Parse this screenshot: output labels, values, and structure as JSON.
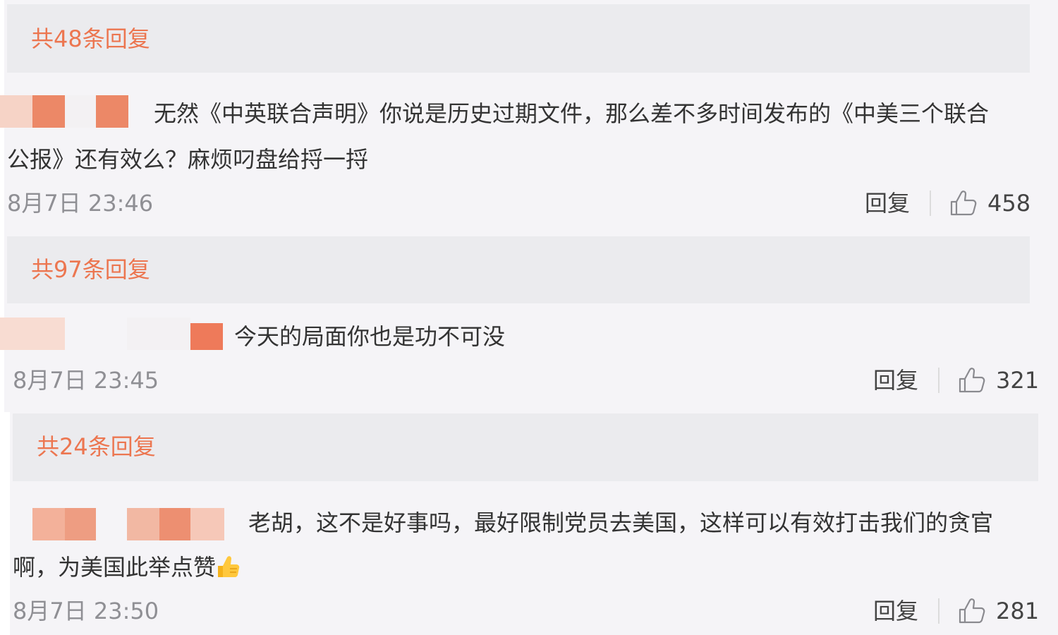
{
  "theme": {
    "reply_count_color": "#ec7650",
    "panel_color": "#f5f4f7",
    "reply_bar_color": "#ebebee",
    "masked_name_color": "#ec7650"
  },
  "comments": [
    {
      "reply_count": "共48条回复",
      "line1": "无然《中英联合声明》你说是历史过期文件，那么差不多时间发布的《中美三个联合",
      "line2": "公报》还有效么？麻烦叼盘给捋一捋",
      "time": "8月7日 23:46",
      "reply_label": "回复",
      "likes": "458"
    },
    {
      "reply_count": "共97条回复",
      "line1": "今天的局面你也是功不可没",
      "time": "8月7日 23:45",
      "reply_label": "回复",
      "likes": "321"
    },
    {
      "reply_count": "共24条回复",
      "line1": "老胡，这不是好事吗，最好限制党员去美国，这样可以有效打击我们的贪官",
      "line2": "啊，为美国此举点赞",
      "line2_emoji": "thumbs-up-emoji",
      "time": "8月7日 23:50",
      "reply_label": "回复",
      "likes": "281"
    }
  ],
  "icons": {
    "like": "thumbs-up-outline-icon"
  }
}
